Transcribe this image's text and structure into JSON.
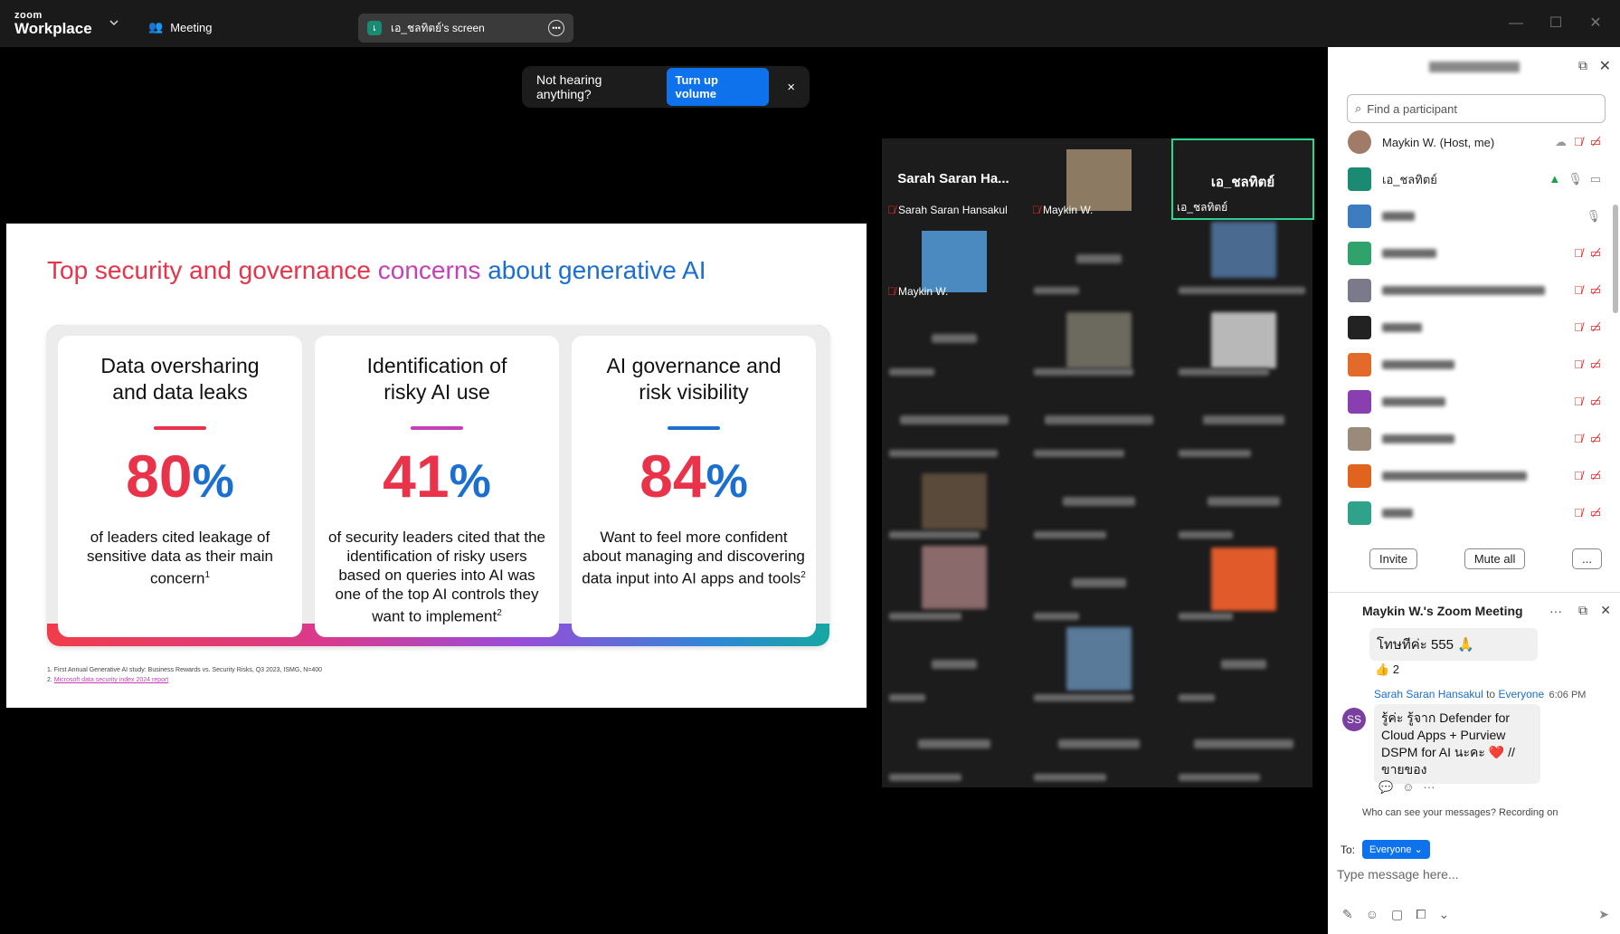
{
  "app": {
    "logo_small": "zoom",
    "logo_big": "Workplace",
    "meeting_tab": "Meeting",
    "screen_share_label": "เอ_ชลทิตย์'s screen"
  },
  "toast": {
    "text": "Not hearing anything?",
    "button": "Turn up volume",
    "close": "×"
  },
  "slide": {
    "title_part1": "Top security and governance ",
    "title_part2": "concerns ",
    "title_part3": "about generative AI",
    "cards": [
      {
        "heading_l1": "Data oversharing",
        "heading_l2": "and data leaks",
        "number": "80",
        "sign": "%",
        "text": "of leaders cited leakage of sensitive data as their main concern",
        "sup": "1",
        "bar_color": "#e8334a"
      },
      {
        "heading_l1": "Identification of",
        "heading_l2": "risky AI use",
        "number": "41",
        "sign": "%",
        "text": "of security leaders cited that the identification of risky users based on queries into AI was one of the top AI controls they want to implement",
        "sup": "2",
        "bar_color": "#c53fb9"
      },
      {
        "heading_l1": "AI governance and",
        "heading_l2": "risk visibility",
        "number": "84",
        "sign": "%",
        "text": "Want to feel more confident about managing and discovering data input into AI apps and tools",
        "sup": "2",
        "bar_color": "#1a6fcf"
      }
    ],
    "footnote1": "1. First Annual Generative AI study: Business Rewards vs. Security Risks, Q3 2023, ISMG, N=400",
    "footnote2_prefix": "2. ",
    "footnote2_link": "Microsoft data security index 2024 report"
  },
  "gallery": {
    "tile_sarah_big": "Sarah Saran Ha...",
    "tile_sarah_label": "Sarah Saran Hansakul",
    "tile_maykin_label": "Maykin W.",
    "tile_ae_big": "เอ_ชลทิตย์",
    "tile_ae_label": "เอ_ชลทิตย์",
    "tile_maykin2_label": "Maykin W."
  },
  "participants": {
    "search_placeholder": "Find a participant",
    "list": [
      {
        "name": "Maykin W. (Host, me)"
      },
      {
        "name": "เอ_ชลทิตย์"
      }
    ],
    "invite": "Invite",
    "mute_all": "Mute all",
    "more": "..."
  },
  "chat": {
    "title": "Maykin W.'s Zoom Meeting",
    "msg1": "โทษทีค่ะ 555 🙏",
    "reaction": "👍 2",
    "sender": "Sarah Saran Hansakul",
    "to_word": "to",
    "recipient": "Everyone",
    "time": "6:06 PM",
    "avatar_initials": "SS",
    "msg2": "รู้ค่ะ รู้จาก Defender for Cloud Apps + Purview DSPM for AI นะคะ ❤️ //ขายของ",
    "privacy": "Who can see your messages? Recording on",
    "to_label": "To:",
    "to_value": "Everyone",
    "input_placeholder": "Type message here..."
  }
}
